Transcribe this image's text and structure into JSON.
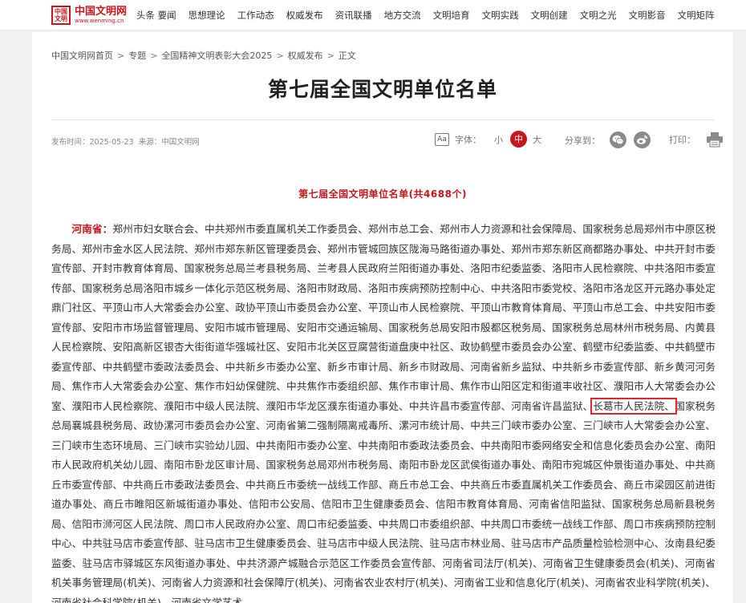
{
  "logo": {
    "seal": "中国文明",
    "name": "中国文明网",
    "url": "www.wenming.cn"
  },
  "nav": [
    "头条 要闻",
    "思想理论",
    "工作动态",
    "权威发布",
    "资讯联播",
    "地方交流",
    "文明培育",
    "文明实践",
    "文明创建",
    "文明之光",
    "文明影音",
    "文明矩阵"
  ],
  "breadcrumb": [
    "中国文明网首页",
    "专题",
    "全国精神文明表彰大会2025",
    "权威发布",
    "正文"
  ],
  "article": {
    "title": "第七届全国文明单位名单",
    "publish_time": "发布时间：2025-05-23",
    "source": "来源：中国文明网",
    "list_title": "第七届全国文明单位名单(共4688个)",
    "province": "河南省：",
    "text_before_highlight": "郑州市妇女联合会、中共郑州市委直属机关工作委员会、郑州市总工会、郑州市人力资源和社会保障局、国家税务总局郑州市中原区税务局、郑州市金水区人民法院、郑州市郑东新区管理委员会、郑州市管城回族区陇海马路街道办事处、郑州市郑东新区商都路办事处、中共开封市委宣传部、开封市教育体育局、国家税务总局兰考县税务局、兰考县人民政府兰阳街道办事处、洛阳市纪委监委、洛阳市人民检察院、中共洛阳市委宣传部、国家税务总局洛阳市城乡一体化示范区税务局、洛阳市财政局、洛阳市疾病预防控制中心、中共洛阳市委党校、洛阳市洛龙区开元路办事处定鼎门社区、平顶山市人大常委会办公室、政协平顶山市委员会办公室、平顶山市人民检察院、平顶山市教育体育局、平顶山市总工会、中共安阳市委宣传部、安阳市市场监督管理局、安阳市城市管理局、安阳市交通运输局、国家税务总局安阳市殷都区税务局、国家税务总局林州市税务局、内黄县人民检察院、安阳高新区银杏大街街道华强城社区、安阳市北关区豆腐营街道盘庚中社区、政协鹤壁市委员会办公室、鹤壁市纪委监委、中共鹤壁市委宣传部、中共鹤壁市委政法委员会、中共新乡市委办公室、新乡市审计局、新乡市财政局、河南省新乡监狱、中共新乡市委宣传部、新乡黄河河务局、焦作市人大常委会办公室、焦作市妇幼保健院、中共焦作市委组织部、焦作市审计局、焦作市山阳区定和街道丰收社区、濮阳市人大常委会办公室、濮阳市人民检察院、濮阳市中级人民法院、濮阳市华龙区濮东街道办事处、中共许昌市委宣传部、河南省许昌监狱、",
    "highlight": "长葛市人民法院、",
    "text_after_highlight": "国家税务总局襄城县税务局、政协漯河市委员会办公室、河南省第二强制隔离戒毒所、漯河市统计局、中共三门峡市委办公室、三门峡市人大常委会办公室、三门峡市生态环境局、三门峡市实验幼儿园、中共南阳市委办公室、中共南阳市委政法委员会、中共南阳市委网络安全和信息化委员会办公室、南阳市人民政府机关幼儿园、南阳市卧龙区审计局、国家税务总局邓州市税务局、南阳市卧龙区武侯街道办事处、南阳市宛城区仲景街道办事处、中共商丘市委宣传部、中共商丘市委政法委员会、中共商丘市委统一战线工作部、商丘市总工会、中共商丘市委直属机关工作委员会、商丘市梁园区前进街道办事处、商丘市睢阳区新城街道办事处、信阳市公安局、信阳市卫生健康委员会、信阳市教育体育局、河南省信阳监狱、国家税务总局新县税务局、信阳市浉河区人民法院、周口市人民政府办公室、周口市纪委监委、中共周口市委组织部、中共周口市委统一战线工作部、周口市疾病预防控制中心、中共驻马店市委宣传部、驻马店市卫生健康委员会、驻马店市中级人民法院、驻马店市林业局、驻马店市产品质量检验检测中心、汝南县纪委监委、驻马店市驿城区东风街道办事处、中共济源产城融合示范区工作委员会宣传部、河南省司法厅(机关)、河南省卫生健康委员会(机关)、河南省机关事务管理局(机关)、河南省人力资源和社会保障厅(机关)、河南省农业农村厅(机关)、河南省工业和信息化厅(机关)、河南省农业科学院(机关)、河南省社会科学院(机关)、河南省文学艺术"
  },
  "toolbar": {
    "fontsize_icon": "Aa",
    "fontsize_label": "字体：",
    "small": "小",
    "medium": "中",
    "large": "大",
    "share_label": "分享到：",
    "print_label": "打印："
  },
  "colors": {
    "accent": "#c8161d",
    "highlight_box": "#e0262f",
    "page_bg": "#f2f2f2",
    "share_icon_bg": "#8a8a8a"
  }
}
